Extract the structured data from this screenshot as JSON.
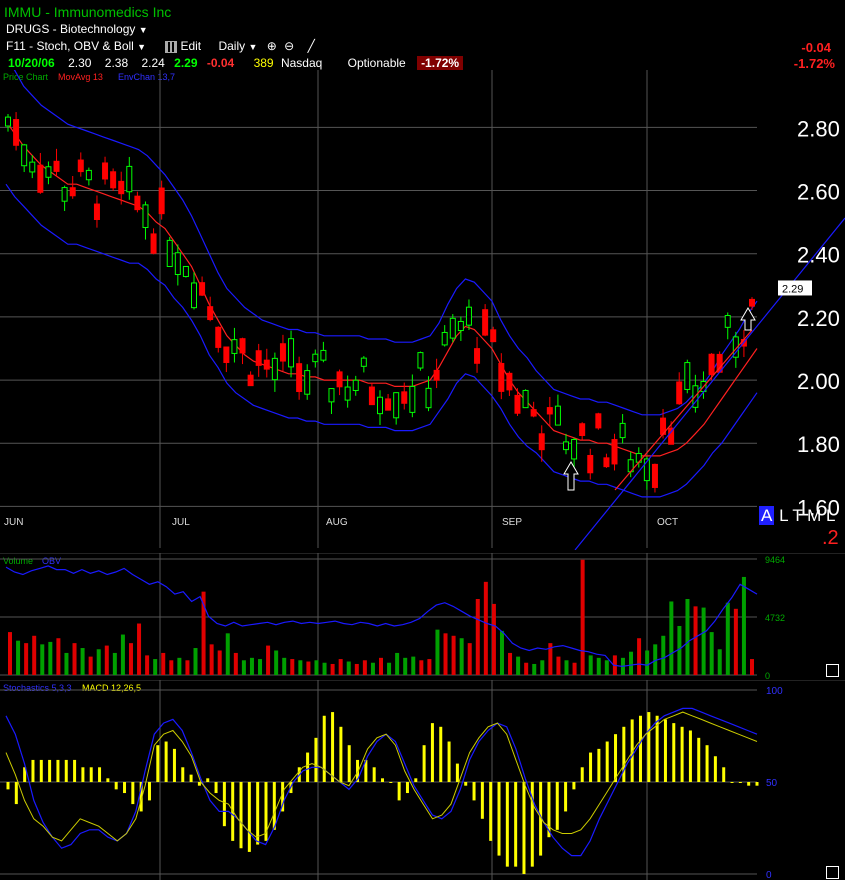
{
  "header": {
    "symbol_title": "IMMU - Immunomedics Inc",
    "watchlist": "DRUGS - Biotechnology",
    "indicator_set": "F11 - Stoch, OBV & Boll",
    "edit_label": "Edit",
    "period": "Daily",
    "date": "10/20/06",
    "open": "2.30",
    "high": "2.38",
    "low": "2.24",
    "close": "2.29",
    "change": "-0.04",
    "volume": "389",
    "exchange": "Nasdaq",
    "optionable": "Optionable",
    "pct_change": "-1.72%",
    "right_change": "-0.04",
    "right_pct_change": "-1.72%"
  },
  "price_legend": {
    "price_chart": "Price Chart",
    "ma": "MovAvg 13",
    "env": "EnvChan 13,7"
  },
  "price_axis_labels": [
    "2.80",
    "2.60",
    "2.40",
    "2.20",
    "2.00",
    "1.80",
    "1.60"
  ],
  "last_price_label": "2.29",
  "month_labels": [
    "JUN",
    "JUL",
    "AUG",
    "SEP",
    "OCT"
  ],
  "timeframe_buttons": {
    "a": "A",
    "l": "L",
    "t": "T",
    "m": "M",
    "l2": "L"
  },
  "right_marker": ".2",
  "volume_legend": {
    "volume": "Volume",
    "obv": "OBV"
  },
  "volume_axis_labels": [
    "9464",
    "4732",
    "0"
  ],
  "osc_legend": {
    "stochastics": "Stochastics 5,3,3",
    "macd": "MACD 12,26,5"
  },
  "osc_axis_labels": [
    "100",
    "50",
    "0"
  ],
  "colors": {
    "up": "#00ff00",
    "down": "#ff0000",
    "ma": "#ff2020",
    "env": "#1a1aff",
    "osc_bar": "#ffff00",
    "stoch": "#cccc00",
    "macd": "#1a1aff",
    "grid": "#555555"
  },
  "chart_data": [
    {
      "type": "candlestick",
      "title": "IMMU - Immunomedics Inc",
      "ylim": [
        1.5,
        2.95
      ],
      "y_ticks": [
        1.6,
        1.8,
        2.0,
        2.2,
        2.4,
        2.6,
        2.8
      ],
      "x_ticks": [
        "JUN",
        "JUL",
        "AUG",
        "SEP",
        "OCT"
      ],
      "series": [
        {
          "name": "MovAvg 13",
          "values": [
            2.82,
            2.78,
            2.74,
            2.71,
            2.68,
            2.66,
            2.64,
            2.62,
            2.62,
            2.61,
            2.6,
            2.59,
            2.58,
            2.57,
            2.56,
            2.55,
            2.53,
            2.5,
            2.48,
            2.44,
            2.4,
            2.36,
            2.3,
            2.24,
            2.19,
            2.14,
            2.11,
            2.08,
            2.06,
            2.05,
            2.04,
            2.03,
            2.02,
            2.02,
            2.01,
            2.01,
            2.0,
            2.0,
            2.0,
            2.0,
            2.0,
            1.99,
            1.99,
            1.99,
            1.98,
            1.98,
            1.98,
            1.99,
            2.0,
            2.04,
            2.09,
            2.14,
            2.17,
            2.16,
            2.13,
            2.1,
            2.05,
            2.0,
            1.96,
            1.93,
            1.9,
            1.87,
            1.84,
            1.83,
            1.82,
            1.81,
            1.81,
            1.8,
            1.8,
            1.79,
            1.78,
            1.77,
            1.76,
            1.76,
            1.76,
            1.77,
            1.78,
            1.8,
            1.83,
            1.86,
            1.9,
            1.94,
            1.98,
            2.02,
            2.06,
            2.1
          ]
        },
        {
          "name": "EnvChan 13,7 upper",
          "values": [
            3.02,
            2.98,
            2.93,
            2.9,
            2.87,
            2.85,
            2.83,
            2.81,
            2.8,
            2.79,
            2.78,
            2.77,
            2.76,
            2.75,
            2.74,
            2.73,
            2.71,
            2.68,
            2.65,
            2.61,
            2.57,
            2.52,
            2.46,
            2.4,
            2.34,
            2.29,
            2.26,
            2.23,
            2.21,
            2.19,
            2.18,
            2.17,
            2.16,
            2.16,
            2.15,
            2.15,
            2.14,
            2.14,
            2.14,
            2.14,
            2.14,
            2.13,
            2.13,
            2.13,
            2.12,
            2.12,
            2.12,
            2.13,
            2.14,
            2.18,
            2.24,
            2.29,
            2.32,
            2.31,
            2.28,
            2.25,
            2.19,
            2.14,
            2.1,
            2.07,
            2.03,
            2.0,
            1.97,
            1.96,
            1.95,
            1.94,
            1.94,
            1.93,
            1.93,
            1.92,
            1.91,
            1.9,
            1.89,
            1.89,
            1.89,
            1.9,
            1.91,
            1.93,
            1.96,
            1.99,
            2.03,
            2.08,
            2.12,
            2.16,
            2.21,
            2.25
          ]
        },
        {
          "name": "EnvChan 13,7 lower",
          "values": [
            2.62,
            2.58,
            2.55,
            2.52,
            2.49,
            2.47,
            2.45,
            2.43,
            2.43,
            2.42,
            2.41,
            2.4,
            2.39,
            2.38,
            2.37,
            2.37,
            2.35,
            2.32,
            2.3,
            2.26,
            2.23,
            2.19,
            2.14,
            2.08,
            2.04,
            1.99,
            1.96,
            1.94,
            1.92,
            1.91,
            1.9,
            1.89,
            1.88,
            1.88,
            1.87,
            1.87,
            1.86,
            1.86,
            1.86,
            1.86,
            1.86,
            1.85,
            1.85,
            1.85,
            1.84,
            1.84,
            1.84,
            1.85,
            1.86,
            1.9,
            1.94,
            1.99,
            2.02,
            2.01,
            1.98,
            1.95,
            1.91,
            1.86,
            1.82,
            1.79,
            1.77,
            1.74,
            1.71,
            1.7,
            1.69,
            1.68,
            1.68,
            1.67,
            1.67,
            1.66,
            1.65,
            1.64,
            1.63,
            1.63,
            1.63,
            1.64,
            1.65,
            1.67,
            1.7,
            1.73,
            1.77,
            1.8,
            1.84,
            1.88,
            1.92,
            1.96
          ]
        }
      ],
      "last_price": 2.29
    },
    {
      "type": "bar",
      "title": "Volume",
      "ylim": [
        0,
        9464
      ],
      "values": [
        3500,
        2800,
        2600,
        3200,
        2500,
        2700,
        3000,
        1800,
        2600,
        2200,
        1500,
        2100,
        2400,
        1800,
        3300,
        2600,
        4200,
        1600,
        1300,
        1800,
        1200,
        1400,
        1200,
        2200,
        6800,
        2500,
        2000,
        3400,
        1800,
        1200,
        1400,
        1300,
        2400,
        2000,
        1400,
        1300,
        1200,
        1100,
        1200,
        1000,
        900,
        1300,
        1100,
        900,
        1200,
        1000,
        1400,
        1000,
        1800,
        1400,
        1500,
        1200,
        1300,
        3700,
        3400,
        3200,
        3000,
        2600,
        6200,
        7600,
        5800,
        3600,
        1800,
        1500,
        1000,
        900,
        1200,
        2600,
        1500,
        1200,
        1000,
        9400,
        1600,
        1400,
        1200,
        1600,
        1400,
        1900,
        3000,
        2000,
        2500,
        3200,
        6000,
        4000,
        6200,
        5600,
        5500,
        3500,
        2100,
        5900,
        5400,
        8000,
        1300
      ],
      "up": [
        0,
        1,
        0,
        0,
        1,
        1,
        0,
        1,
        0,
        1,
        0,
        1,
        0,
        1,
        1,
        0,
        0,
        0,
        1,
        0,
        0,
        1,
        0,
        1,
        0,
        0,
        0,
        1,
        0,
        1,
        1,
        1,
        0,
        1,
        1,
        0,
        1,
        0,
        1,
        1,
        0,
        0,
        1,
        0,
        0,
        1,
        0,
        1,
        1,
        1,
        1,
        0,
        0,
        1,
        0,
        0,
        1,
        0,
        0,
        0,
        0,
        1,
        0,
        1,
        0,
        1,
        1,
        0,
        0,
        1,
        0,
        0,
        1,
        1,
        1,
        0,
        1,
        1,
        0,
        1,
        1,
        1,
        1,
        1,
        1,
        0,
        1,
        1,
        1,
        1,
        0,
        1,
        0
      ],
      "obv": [
        8800,
        8400,
        8200,
        8500,
        8700,
        8900,
        8600,
        8600,
        8300,
        8600,
        8300,
        8500,
        8200,
        8400,
        8700,
        8200,
        7800,
        7400,
        7600,
        7200,
        6600,
        6800,
        6000,
        6400,
        4800,
        4200,
        4000,
        4300,
        4000,
        4100,
        4200,
        4300,
        4100,
        4300,
        4400,
        4200,
        4300,
        4200,
        4300,
        4400,
        4200,
        4100,
        4300,
        4200,
        4000,
        4200,
        4000,
        4100,
        4300,
        4600,
        5200,
        5700,
        5900,
        5600,
        5200,
        4800,
        4500,
        4200,
        4000,
        3400,
        2600,
        2200,
        2000,
        2200,
        2100,
        2300,
        2400,
        2200,
        2000,
        1900,
        1700,
        1600,
        800,
        700,
        800,
        900,
        800,
        1200,
        1400,
        1800,
        2200,
        2800,
        3200,
        3600,
        4400,
        5400,
        6300,
        7400,
        7000,
        6600
      ]
    },
    {
      "type": "bar",
      "title": "Stochastics 5,3,3 / MACD 12,26,5",
      "ylim": [
        0,
        100
      ],
      "values": [
        46,
        38,
        58,
        62,
        62,
        62,
        62,
        62,
        62,
        58,
        58,
        58,
        52,
        46,
        44,
        38,
        34,
        40,
        70,
        72,
        68,
        58,
        54,
        48,
        52,
        44,
        26,
        18,
        14,
        12,
        16,
        18,
        24,
        34,
        44,
        58,
        66,
        74,
        86,
        88,
        80,
        70,
        62,
        62,
        58,
        52,
        50,
        40,
        44,
        52,
        70,
        82,
        80,
        72,
        60,
        48,
        40,
        30,
        18,
        10,
        4,
        4,
        0,
        4,
        10,
        20,
        24,
        34,
        46,
        58,
        66,
        68,
        72,
        76,
        80,
        84,
        86,
        88,
        86,
        84,
        82,
        80,
        78,
        74,
        70,
        64,
        58,
        50,
        50,
        48,
        48
      ],
      "stoch": [
        66,
        54,
        40,
        30,
        26,
        20,
        18,
        24,
        30,
        28,
        26,
        22,
        18,
        22,
        30,
        48,
        70,
        76,
        78,
        72,
        64,
        50,
        44,
        40,
        38,
        30,
        24,
        20,
        22,
        34,
        46,
        52,
        58,
        60,
        58,
        54,
        50,
        48,
        56,
        68,
        74,
        76,
        70,
        56,
        46,
        38,
        30,
        32,
        38,
        52,
        66,
        74,
        80,
        82,
        76,
        62,
        48,
        36,
        28,
        24,
        22,
        22,
        24,
        30,
        38,
        46,
        54,
        62,
        70,
        76,
        80,
        84,
        86,
        88,
        86,
        84,
        82,
        80,
        78,
        76,
        74,
        72
      ],
      "macd": [
        86,
        76,
        60,
        40,
        28,
        20,
        14,
        16,
        22,
        24,
        24,
        20,
        18,
        22,
        34,
        56,
        76,
        82,
        84,
        78,
        66,
        52,
        40,
        34,
        34,
        30,
        24,
        18,
        16,
        26,
        40,
        50,
        56,
        58,
        58,
        54,
        50,
        46,
        52,
        64,
        72,
        76,
        72,
        60,
        48,
        40,
        32,
        30,
        34,
        46,
        62,
        72,
        78,
        82,
        80,
        68,
        52,
        38,
        28,
        20,
        14,
        10,
        10,
        18,
        30,
        40,
        50,
        60,
        68,
        76,
        82,
        86,
        88,
        90,
        90,
        88,
        86,
        84,
        82,
        80,
        78,
        76
      ]
    }
  ]
}
